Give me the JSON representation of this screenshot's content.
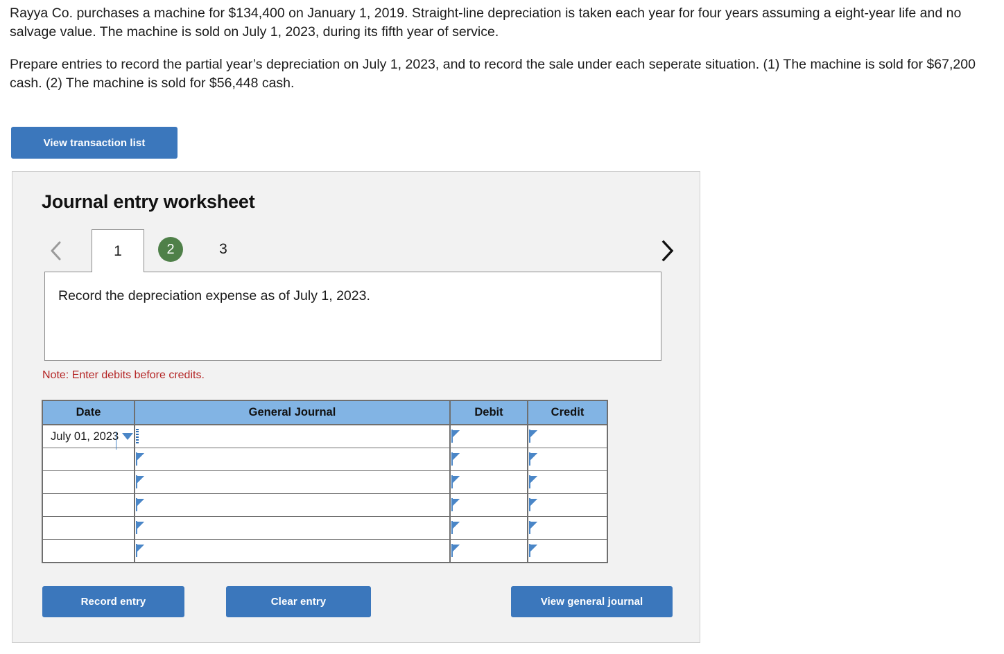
{
  "problem": {
    "paragraph_1": "Rayya Co. purchases a machine for $134,400 on January 1, 2019. Straight-line depreciation is taken each year for four years assuming a eight-year life and no salvage value. The machine is sold on July 1, 2023, during its fifth year of service.",
    "paragraph_2": "Prepare entries to record the partial year’s depreciation on July 1, 2023, and to record the sale under each seperate situation.  (1) The machine is sold for $67,200 cash. (2) The machine is sold for $56,448 cash."
  },
  "toolbar": {
    "view_transaction_list_label": "View transaction list"
  },
  "worksheet": {
    "title": "Journal entry worksheet",
    "nav": {
      "prev_icon": "chevron-left-icon",
      "next_icon": "chevron-right-icon"
    },
    "tabs": [
      {
        "label": "1",
        "state": "active",
        "style": "tab"
      },
      {
        "label": "2",
        "state": "current",
        "style": "badge"
      },
      {
        "label": "3",
        "state": "normal",
        "style": "plain"
      }
    ],
    "description": "Record the depreciation expense as of July 1, 2023.",
    "note": "Note: Enter debits before credits.",
    "table": {
      "headers": [
        "Date",
        "General Journal",
        "Debit",
        "Credit"
      ],
      "rows": [
        {
          "date": "July 01, 2023",
          "general_journal": "",
          "debit": "",
          "credit": "",
          "selected": true
        },
        {
          "date": "",
          "general_journal": "",
          "debit": "",
          "credit": "",
          "selected": false
        },
        {
          "date": "",
          "general_journal": "",
          "debit": "",
          "credit": "",
          "selected": false
        },
        {
          "date": "",
          "general_journal": "",
          "debit": "",
          "credit": "",
          "selected": false
        },
        {
          "date": "",
          "general_journal": "",
          "debit": "",
          "credit": "",
          "selected": false
        },
        {
          "date": "",
          "general_journal": "",
          "debit": "",
          "credit": "",
          "selected": false
        }
      ]
    },
    "actions": {
      "record_entry_label": "Record entry",
      "clear_entry_label": "Clear entry",
      "view_general_journal_label": "View general journal"
    }
  },
  "colors": {
    "button_blue": "#3b77bc",
    "header_blue": "#82b4e4",
    "badge_green": "#4f8049",
    "note_red": "#b42525",
    "panel_gray": "#f2f2f2",
    "cell_border_blue": "#4a86c7"
  }
}
